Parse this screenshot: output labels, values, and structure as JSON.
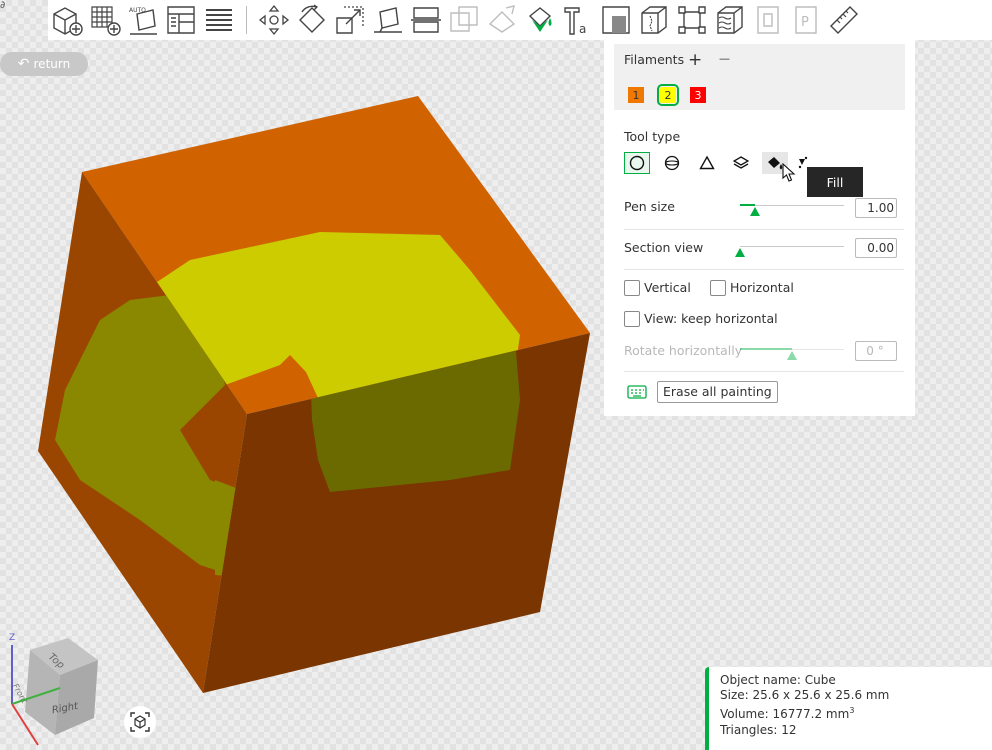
{
  "toolbar": {
    "tools": [
      "add-object-icon",
      "arrange-grid-icon",
      "auto-orient-icon",
      "layout-icon",
      "split-to-parts-icon",
      "move-icon",
      "rotate-icon",
      "scale-icon",
      "lay-on-face-icon",
      "cut-icon",
      "boolean-icon",
      "support-paint-icon",
      "color-paint-icon",
      "text-icon",
      "emboss-icon",
      "seam-paint-icon",
      "simplify-icon",
      "fuzzy-skin-icon",
      "variable-layer-icon",
      "assembly-view-icon",
      "measure-icon"
    ],
    "auto_label": "AUTO"
  },
  "return_button": {
    "label": "return"
  },
  "panel": {
    "filaments_title": "Filaments",
    "add_label": "+",
    "remove_label": "—",
    "filaments": [
      {
        "label": "1",
        "color": "#f07800"
      },
      {
        "label": "2",
        "color": "#ffff00",
        "selected": true
      },
      {
        "label": "3",
        "color": "#ff0000"
      }
    ],
    "tool_type_label": "Tool type",
    "tools": [
      "circle-brush-icon",
      "sphere-brush-icon",
      "triangle-brush-icon",
      "height-range-icon",
      "fill-icon",
      "gap-fill-icon"
    ],
    "pen_size_label": "Pen size",
    "pen_size_value": "1.00",
    "pen_size_level": 0.14,
    "section_view_label": "Section view",
    "section_view_value": "0.00",
    "section_view_level": 0.0,
    "vertical_label": "Vertical",
    "horizontal_label": "Horizontal",
    "keep_horizontal_label": "View: keep horizontal",
    "rotate_label": "Rotate horizontally",
    "rotate_value": "0 °",
    "rotate_level": 0.5,
    "erase_button": "Erase all painting"
  },
  "tooltip": {
    "text": "Fill"
  },
  "info": {
    "name": "Object name: Cube",
    "size": "Size: 25.6 x 25.6 x 25.6 mm",
    "volume": "Volume: 16777.2 mm",
    "volume_unit_sup": "3",
    "triangles": "Triangles: 12"
  },
  "colors": {
    "accent": "#00ae42",
    "cube_top": "#d06200",
    "cube_left": "#9a4500",
    "cube_right": "#7a3500",
    "paint": "#d8d400"
  },
  "nav_cube": {
    "top": "Top",
    "front": "Front",
    "right": "Right",
    "z": "Z"
  }
}
